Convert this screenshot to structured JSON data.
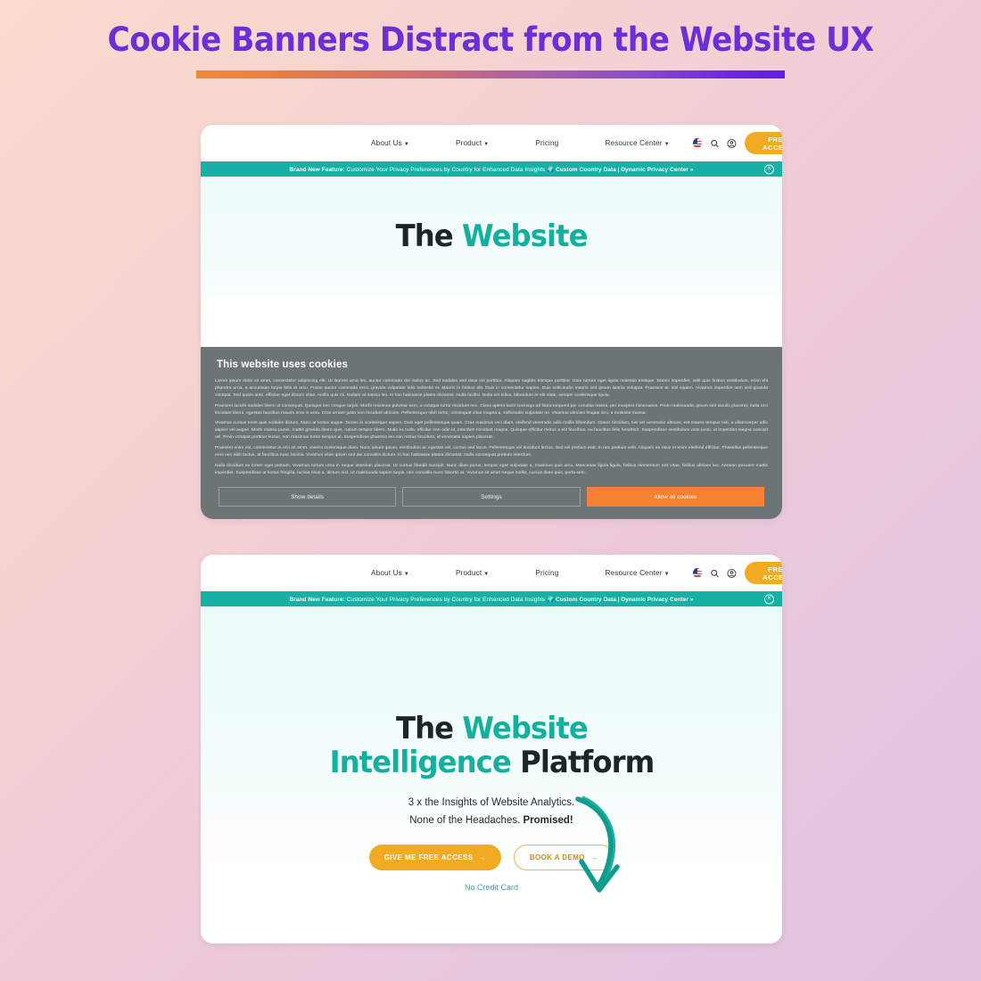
{
  "headline": "Cookie Banners Distract from the Website UX",
  "colors": {
    "accent_purple": "#6b2fd6",
    "accent_orange": "#f08a35",
    "brand_teal": "#13b09e",
    "announce_teal": "#14b1a4",
    "cta_gold": "#f0ab22",
    "cookie_gray": "#6c7476",
    "allow_orange": "#f58231",
    "page_bg_start": "#f9dccd",
    "page_bg_end": "#e0c2dd",
    "hero_bg": "#eefcfa"
  },
  "nav": {
    "links": [
      {
        "label": "About Us",
        "has_caret": true
      },
      {
        "label": "Product",
        "has_caret": true
      },
      {
        "label": "Pricing",
        "has_caret": false
      },
      {
        "label": "Resource Center",
        "has_caret": true
      }
    ],
    "icons": [
      "flag-icon",
      "search-icon",
      "account-icon"
    ],
    "cta_label": "FREE ACCESS",
    "cta_arrow": "→"
  },
  "announcement": {
    "lead": "Brand New Feature:",
    "body": " Customize Your Privacy Preferences by Country for Enhanced Data Insights 🌍 ",
    "links": "Custom Country Data | Dynamic Privacy Center »",
    "close_glyph": "✕"
  },
  "panel_one": {
    "hero": {
      "line1_dark": "The ",
      "line1_teal": "Website"
    },
    "cookie": {
      "title": "This website uses cookies",
      "paragraphs": [
        "Lorem ipsum dolor sit amet, consectetur adipiscing elit. Ut laoreet urna leo, auctor commodo dui varius ac. Sed sodales sed risus vel porttitor. Aliquam sagittis tristique porttitor. Duis rutrum eget ligula molestie tristique. Donec imperdiet, velit quis finibus vestibulum, enim elit pharetra urna, a accumsan turpis felis at arcu. Fusce auctor commodo eros, gravida vulputate felis molestie et. Mauris in finibus elit. Duis in consectetur sapien. Duis sollicitudin mauris sed ipsum lacinia volutpat. Praesent ac nisl sapien. Vivamus imperdiet sem sed gravida volutpat. Sed quam ante, efficitur eget dictum vitae, mollis quis mi. Nullam at massa leo. In hac habitasse platea dictumst. Nulla facilisi. Nulla est tellus, bibendum et elit vitae, semper scelerisque ligula.",
        "Praesent iaculis sodales libero ut consequat. Quisque nec congue turpis. Morbi maximus pulvinar sem, a volutpat tortor tincidunt nec. Class aptent taciti sociosqu ad litora torquent per conubia nostra, per inceptos himenaeos. Proin malesuada, ipsum sed iaculis placerat, nulla orci tincidunt libero, egestas faucibus mauris eros in urna. Cras ornare justo non tincidunt ultricies. Pellentesque nibh tortor, consequat vitae magna a, sollicitudin vulputate mi. Vivamus ultricies feugiat orci, a molestie massa.",
        "Vivamus cursus enim quis sodales dictum. Nunc at lectus augue. Donec in scelerisque sapien. Duis eget pellentesque quam. Cras maximus orci diam, eleifend venenatis odio mollis bibendum. Donec tincidunt, nisl vel venenatis ultrices, est mauris tempus nisl, a ullamcorper odio sapien vel augue. Morbi massa purus, mattis gravida libero quis, rutrum tempor libero. Nulla ex nulla, efficitur non odio id, interdum tincidunt magna. Quisque efficitur metus a elit faucibus, eu faucibus felis hendrerit. Suspendisse vestibulum ante justo, ut imperdiet magna suscipit vel. Proin volutpat porttitor lectus, non maximus tortor tempus ut. Suspendisse pharetra leo non metus tincidunt, id venenatis sapien placerat.",
        "Praesent enim est, consectetur in orci sit amet, viverra scelerisque diam. Nunc ipsum ipsum, vestibulum ac egestas vel, cursus sed lacus. Pellentesque vel tincidunt lectus. Sed vel pretium erat. In nec pretium velit. Aliquam eu risus et enim eleifend efficitur. Phasellus pellentesque eros nec nibh luctus, at faucibus nunc lacinia. Vivamus vitae ipsum sed dui convallis dictum. In hac habitasse platea dictumst. Nulla consequat pretium interdum.",
        "Nulla tincidunt eu lorem eget pretium. Vivamus rutrum urna in neque interdum placerat. Ut cursus blandit suscipit. Nunc diam purus, tempor eget vulputate a, maximus quis arcu. Maecenas ligula ligula, finibus elementum nisl vitae, finibus ultrices leo. Aenean posuere mattis imperdiet. Suspendisse ut lectus fringilla, lacinia risus a, dictum nisl. Ut malesuada sapien turpis, nec convallis nunc lobortis at. Vivamus sit amet neque mollis, cursus diam quis, porta sem."
      ],
      "buttons": [
        {
          "label": "Show details",
          "style": "outline"
        },
        {
          "label": "Settings",
          "style": "outline"
        },
        {
          "label": "Allow all cookies",
          "style": "accent"
        }
      ]
    }
  },
  "panel_two": {
    "hero": {
      "line1_dark": "The ",
      "line1_teal": "Website",
      "line2_teal": "Intelligence",
      "line2_dark": " Platform",
      "sub_line1": "3 x the Insights of Website Analytics.",
      "sub_line2_plain": "None of the Headaches. ",
      "sub_line2_bold": "Promised!",
      "cta_primary": "GIVE ME FREE ACCESS",
      "cta_primary_arrow": "→",
      "cta_secondary": "BOOK A DEMO",
      "cta_secondary_arrow": "→",
      "no_credit_card": "No Credit Card"
    }
  }
}
